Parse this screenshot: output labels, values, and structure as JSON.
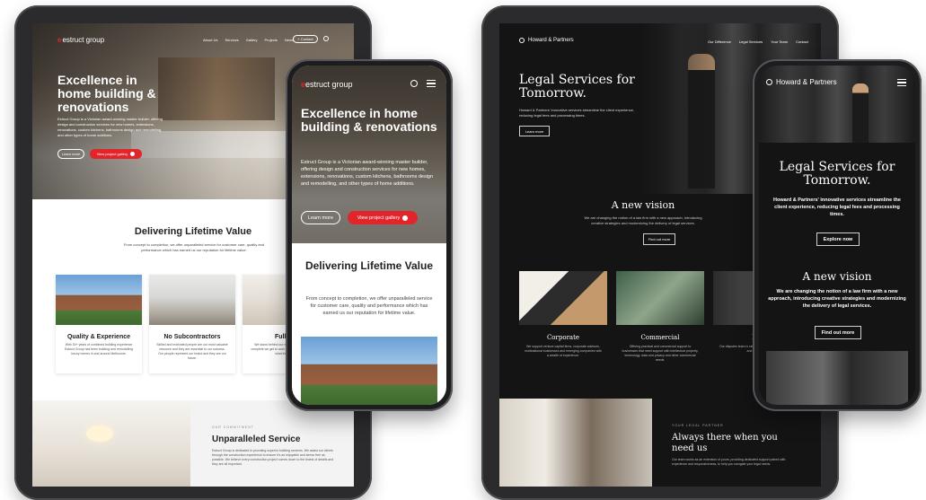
{
  "estruct": {
    "brand": "estruct group",
    "nav": [
      "About Us",
      "Services",
      "Gallery",
      "Projects",
      "News"
    ],
    "contact_btn": "+ Contact",
    "hero_title": "Excellence in home building & renovations",
    "hero_text_short": "Estruct Group is a Victorian award-winning master builder, offering design and construction services for new homes, extensions, renovations, custom kitchens, bathrooms design and remodelling, and other types of home additions.",
    "learn_more": "Learn more",
    "view_gallery": "View project gallery",
    "value_title": "Delivering Lifetime Value",
    "value_text": "From concept to completion, we offer unparalleled service for customer care, quality and performance which has earned us our reputation for lifetime value.",
    "cards": [
      {
        "title": "Quality & Experience",
        "text": "With 30+ years of combined building experience Estruct Group has been building and remodelling luxury homes in and around Melbourne."
      },
      {
        "title": "No Subcontractors",
        "text": "Skilled and motivated people are our most valuable resource and they are essential to our success. Our people represent our brand and they are our future."
      },
      {
        "title": "Fully M",
        "text": "We stand behind our work. Once every job is complete we get to work with our clients and build what they love."
      }
    ],
    "commit_eyebrow": "OUR COMMITMENT",
    "commit_title": "Unparalleled Service",
    "commit_text": "Estruct Group is dedicated to providing superior building services. We assist our clients through the construction experience to ensure it's as enjoyable and stress free as possible. We believe every construction project comes down to the tiniest of details and they are all important."
  },
  "legal": {
    "brand": "Howard & Partners",
    "nav": [
      "Our Difference",
      "Legal Services",
      "Your Team",
      "Contact"
    ],
    "hero_title": "Legal Services for Tomorrow.",
    "hero_text": "Howard & Partners' innovative services streamline the client experience, reducing legal fees and processing times.",
    "learn_more": "Learn more",
    "explore_now": "Explore now",
    "vision_title": "A new vision",
    "vision_text": "We are changing the notion of a law firm with a new approach, introducing creative strategies and modernizing the delivery of legal services.",
    "vision_text_mobile": "We are changing the notion of a law firm with a new approach, introducing creative strategies and modernizing the delivery of legal services.",
    "find_out_more": "Find out more",
    "services": [
      {
        "title": "Corporate",
        "text": "We support venture capital firms, corporate advisors, multinational businesses and emerging companies with a wealth of experience."
      },
      {
        "title": "Commercial",
        "text": "Offering practical and commercial support to businesses that need support with intellectual property, technology, data and privacy and other commercial needs."
      },
      {
        "title": "Liti",
        "text": "Our disputes team is skilled to help handle all litigation and resolution."
      }
    ],
    "partner_eyebrow": "YOUR LEGAL PARTNER",
    "partner_title": "Always there when you need us",
    "partner_text": "Our team works as an extension of yours, providing dedicated support paired with experience and responsiveness, to help you navigate your legal needs."
  }
}
